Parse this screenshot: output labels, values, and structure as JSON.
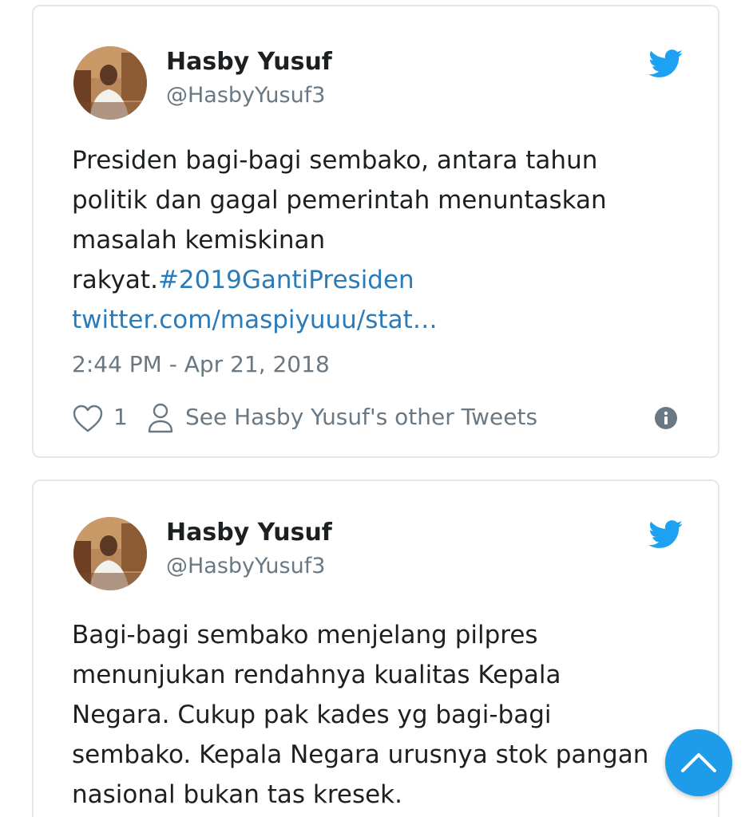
{
  "colors": {
    "twitter_blue": "#1da1f2",
    "link_blue": "#2b7bb9",
    "scroll_button_blue": "#1e9be9",
    "text_dark": "#1c2022",
    "text_muted": "#697882",
    "border": "#e1e8ed"
  },
  "tweets": [
    {
      "author_name": "Hasby Yusuf",
      "author_handle": "@HasbyYusuf3",
      "text_lines": [
        "Presiden bagi-bagi sembako, antara tahun",
        "politik dan gagal pemerintah menuntaskan",
        "masalah kemiskinan"
      ],
      "text_tail": "rakyat.",
      "hashtag": "#2019GantiPresiden",
      "link": "twitter.com/maspiyuuu/stat…",
      "timestamp": "2:44 PM - Apr 21, 2018",
      "like_count": "1",
      "other_tweets_label": "See Hasby Yusuf's other Tweets",
      "icons": [
        "twitter-bird-icon",
        "heart-icon",
        "person-icon",
        "info-icon"
      ]
    },
    {
      "author_name": "Hasby Yusuf",
      "author_handle": "@HasbyYusuf3",
      "text_lines": [
        "Bagi-bagi sembako menjelang pilpres",
        "menunjukan rendahnya kualitas Kepala",
        "Negara. Cukup pak kades yg bagi-bagi",
        "sembako. Kepala Negara urusnya stok pangan",
        "nasional bukan tas kresek."
      ],
      "icons": [
        "twitter-bird-icon"
      ]
    }
  ],
  "scroll_to_top": {
    "icon": "chevron-up-icon"
  }
}
